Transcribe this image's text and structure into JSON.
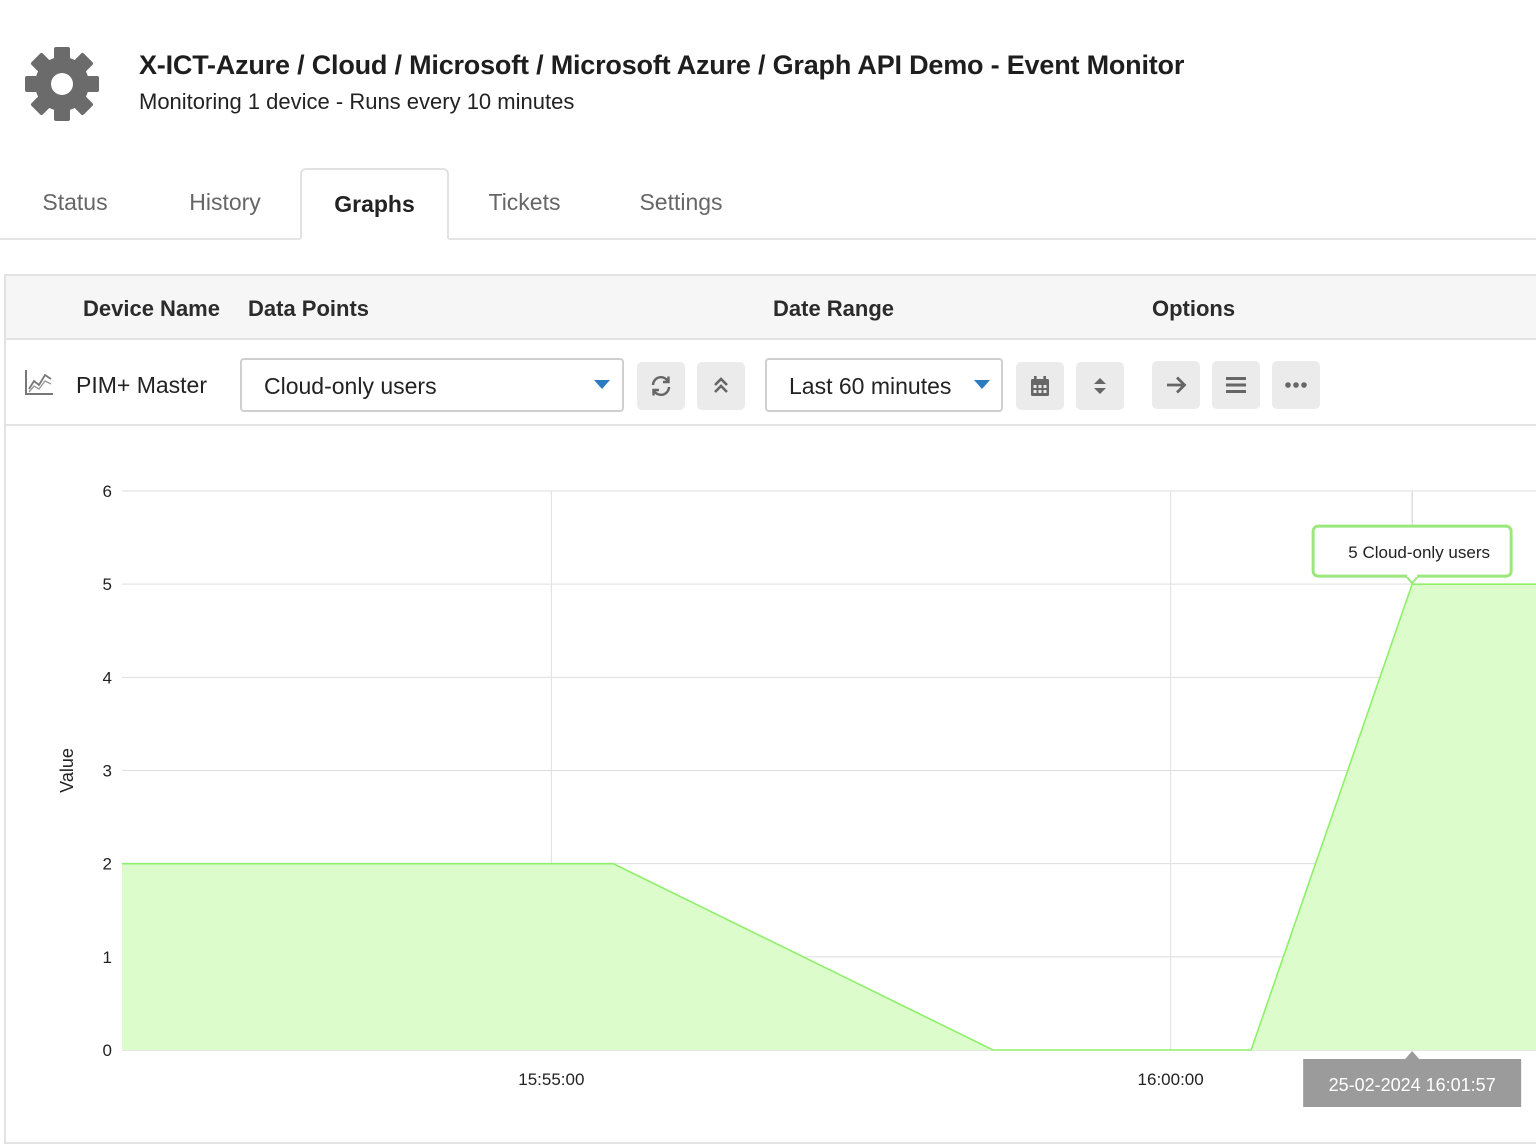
{
  "header": {
    "title": "X-ICT-Azure / Cloud / Microsoft / Microsoft Azure / Graph API Demo - Event Monitor",
    "subtitle": "Monitoring 1 device - Runs every 10 minutes",
    "icon": "gear-icon"
  },
  "tabs": [
    {
      "label": "Status",
      "active": false
    },
    {
      "label": "History",
      "active": false
    },
    {
      "label": "Graphs",
      "active": true
    },
    {
      "label": "Tickets",
      "active": false
    },
    {
      "label": "Settings",
      "active": false
    }
  ],
  "table": {
    "columns": {
      "device_name": "Device Name",
      "data_points": "Data Points",
      "date_range": "Date Range",
      "options": "Options"
    },
    "row": {
      "device_icon": "line-chart-icon",
      "device_name": "PIM+ Master",
      "data_point_selected": "Cloud-only users",
      "date_range_selected": "Last 60 minutes"
    },
    "buttons": [
      {
        "name": "refresh-button",
        "icon": "refresh-icon"
      },
      {
        "name": "collapse-button",
        "icon": "double-chevron-up-icon"
      },
      {
        "name": "calendar-button",
        "icon": "calendar-icon"
      },
      {
        "name": "sort-button",
        "icon": "sort-icon"
      },
      {
        "name": "forward-button",
        "icon": "arrow-right-icon"
      },
      {
        "name": "menu-button",
        "icon": "hamburger-icon"
      },
      {
        "name": "more-button",
        "icon": "ellipsis-icon"
      }
    ]
  },
  "colors": {
    "accent": "#2a7bc0",
    "series_fill": "#dcfccb",
    "series_line": "#8ef06a",
    "tooltip_border": "#9ae87c",
    "crosshair_label_bg": "#9b9b9b"
  },
  "chart_data": {
    "type": "area",
    "ylabel": "Value",
    "ylim": [
      0,
      6
    ],
    "yticks": [
      0,
      1,
      2,
      3,
      4,
      5,
      6
    ],
    "xlim": [
      "15:51:32",
      "16:02:57"
    ],
    "xticks": [
      "15:55:00",
      "16:00:00"
    ],
    "series": [
      {
        "points": [
          {
            "x": "15:51:32",
            "y": 2
          },
          {
            "x": "15:55:30",
            "y": 2
          },
          {
            "x": "15:58:34",
            "y": 0
          },
          {
            "x": "16:00:39",
            "y": 0
          },
          {
            "x": "16:01:57",
            "y": 5
          },
          {
            "x": "16:02:57",
            "y": 5
          }
        ]
      }
    ],
    "tooltip": {
      "text": "5 Cloud-only users",
      "x": "16:01:57",
      "y": 5
    },
    "crosshair": {
      "x": "16:01:57",
      "label": "25-02-2024 16:01:57"
    }
  }
}
